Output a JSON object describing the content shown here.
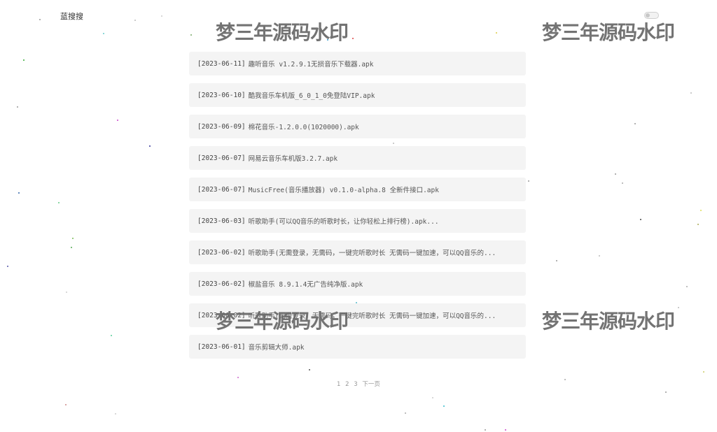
{
  "header": {
    "brand": "蓝搜搜"
  },
  "items": [
    {
      "date": "[2023-06-11]",
      "title": "趣听音乐 v1.2.9.1无损音乐下载器.apk"
    },
    {
      "date": "[2023-06-10]",
      "title": "酷我音乐车机版_6_0_1_0免登陆VIP.apk"
    },
    {
      "date": "[2023-06-09]",
      "title": "棉花音乐-1.2.0.0(1020000).apk"
    },
    {
      "date": "[2023-06-07]",
      "title": "网易云音乐车机版3.2.7.apk"
    },
    {
      "date": "[2023-06-07]",
      "title": "MusicFree(音乐播放器) v0.1.0-alpha.8 全新件接口.apk"
    },
    {
      "date": "[2023-06-03]",
      "title": "听歌助手(可以QQ音乐的听歌时长，让你轻松上排行榜).apk..."
    },
    {
      "date": "[2023-06-02]",
      "title": "听歌助手(无需登录，无需码，一键完听歌时长 无需码一键加速，可以QQ音乐的..."
    },
    {
      "date": "[2023-06-02]",
      "title": "椒盐音乐 8.9.1.4无广告纯净版.apk"
    },
    {
      "date": "[2023-06-02]",
      "title": "听歌助手(无需登录，无需码，一键完听歌时长 无需码一键加速，可以QQ音乐的..."
    },
    {
      "date": "[2023-06-01]",
      "title": "音乐剪辑大师.apk"
    }
  ],
  "pagination": {
    "pages": [
      "1",
      "2",
      "3"
    ],
    "next": "下一页"
  },
  "watermark": {
    "text": "梦三年源码水印"
  }
}
